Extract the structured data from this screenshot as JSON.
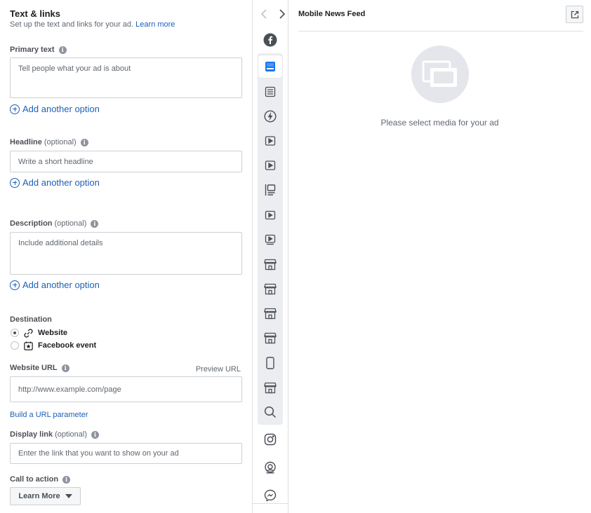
{
  "section": {
    "title": "Text & links",
    "subtitle": "Set up the text and links for your ad.",
    "learn_more": "Learn more"
  },
  "primary_text": {
    "label": "Primary text",
    "placeholder": "Tell people what your ad is about",
    "add_option": "Add another option"
  },
  "headline": {
    "label": "Headline",
    "optional": "(optional)",
    "placeholder": "Write a short headline",
    "add_option": "Add another option"
  },
  "description": {
    "label": "Description",
    "optional": "(optional)",
    "placeholder": "Include additional details",
    "add_option": "Add another option"
  },
  "destination": {
    "label": "Destination",
    "options": [
      {
        "label": "Website",
        "selected": true,
        "icon": "link-icon"
      },
      {
        "label": "Facebook event",
        "selected": false,
        "icon": "calendar-star-icon"
      }
    ]
  },
  "website_url": {
    "label": "Website URL",
    "preview_label": "Preview URL",
    "placeholder": "http://www.example.com/page",
    "build_param": "Build a URL parameter"
  },
  "display_link": {
    "label": "Display link",
    "optional": "(optional)",
    "placeholder": "Enter the link that you want to show on your ad"
  },
  "cta": {
    "label": "Call to action",
    "value": "Learn More"
  },
  "placements": [
    "facebook-icon",
    "mobile-feed-icon",
    "desktop-feed-icon",
    "instant-articles-icon",
    "in-stream-video-icon",
    "in-stream-video-alt-icon",
    "right-column-icon",
    "video-feeds-icon",
    "suggested-video-icon",
    "marketplace-icon",
    "marketplace-alt-icon",
    "marketplace-search-icon",
    "marketplace-listing-icon",
    "stories-icon",
    "marketplace-stories-icon",
    "search-icon",
    "instagram-icon",
    "audience-network-icon",
    "messenger-icon"
  ],
  "preview": {
    "title": "Mobile News Feed",
    "empty_message": "Please select media for your ad"
  },
  "colors": {
    "accent": "#1d5fb8",
    "selected_icon": "#1877f2",
    "border": "#ccd0d5"
  }
}
